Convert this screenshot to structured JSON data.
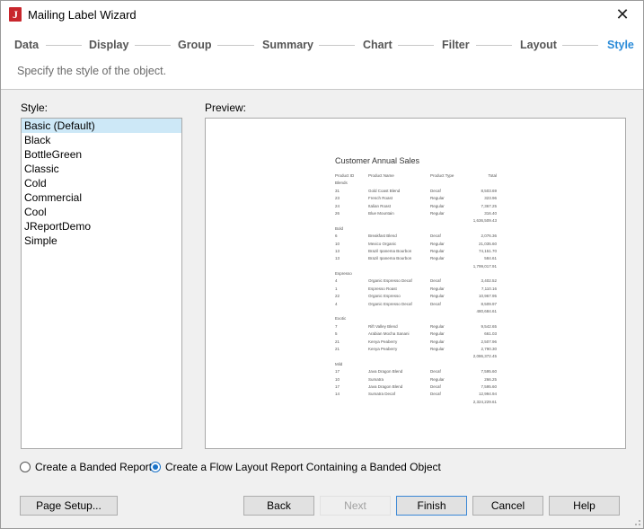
{
  "window": {
    "title": "Mailing Label Wizard",
    "app_icon_letter": "J",
    "close_glyph": "✕"
  },
  "steps": [
    "Data",
    "Display",
    "Group",
    "Summary",
    "Chart",
    "Filter",
    "Layout",
    "Style"
  ],
  "subtitle": "Specify the style of the object.",
  "style_label": "Style:",
  "preview_label": "Preview:",
  "styles": [
    "Basic (Default)",
    "Black",
    "BottleGreen",
    "Classic",
    "Cold",
    "Commercial",
    "Cool",
    "JReportDemo",
    "Simple"
  ],
  "selected_style": "Basic (Default)",
  "report": {
    "title": "Customer Annual Sales",
    "headers": [
      "Product ID",
      "Product Name",
      "Product Type",
      "Total"
    ],
    "rows": [
      [
        "Blends",
        "",
        "",
        ""
      ],
      [
        "31",
        "Gold Coast Blend",
        "Decaf",
        "8,503.69"
      ],
      [
        "23",
        "French Roast",
        "Regular",
        "323.96"
      ],
      [
        "24",
        "Italian Roast",
        "Regular",
        "7,367.25"
      ],
      [
        "26",
        "Blue Mountain",
        "Regular",
        "316.40"
      ],
      [
        "",
        "",
        "",
        "1,636,509.43"
      ],
      [
        "Bold",
        "",
        "",
        ""
      ],
      [
        "6",
        "Breakfast Blend",
        "Decaf",
        "2,076.36"
      ],
      [
        "10",
        "Mexico Organic",
        "Regular",
        "21,035.60"
      ],
      [
        "13",
        "Brazil Ipanema Bourbon",
        "Regular",
        "74,151.70"
      ],
      [
        "13",
        "Brazil Ipanema Bourbon",
        "Regular",
        "584.61"
      ],
      [
        "",
        "",
        "",
        "1,799,017.91"
      ],
      [
        "Espresso",
        "",
        "",
        ""
      ],
      [
        "4",
        "Organic Espresso Decaf",
        "Decaf",
        "3,402.52"
      ],
      [
        "1",
        "Espresso Roast",
        "Regular",
        "7,110.16"
      ],
      [
        "22",
        "Organic Espresso",
        "Regular",
        "10,967.95"
      ],
      [
        "4",
        "Organic Espresso Decaf",
        "Decaf",
        "8,509.97"
      ],
      [
        "",
        "",
        "",
        "480,684.61"
      ],
      [
        "Exotic",
        "",
        "",
        ""
      ],
      [
        "7",
        "Rift Valley Blend",
        "Regular",
        "9,542.65"
      ],
      [
        "5",
        "Arabian Mocha Sanani",
        "Regular",
        "661.03"
      ],
      [
        "21",
        "Kenya Peaberry",
        "Regular",
        "2,507.96"
      ],
      [
        "21",
        "Kenya Peaberry",
        "Regular",
        "2,790.30"
      ],
      [
        "",
        "",
        "",
        "2,086,372.45"
      ],
      [
        "Mild",
        "",
        "",
        ""
      ],
      [
        "17",
        "Java Dragon Blend",
        "Decaf",
        "7,595.60"
      ],
      [
        "10",
        "Sumatra",
        "Regular",
        "266.25"
      ],
      [
        "17",
        "Java Dragon Blend",
        "Decaf",
        "7,595.60"
      ],
      [
        "14",
        "Sumatra Decaf",
        "Decaf",
        "12,994.94"
      ],
      [
        "",
        "",
        "",
        "2,324,229.61"
      ]
    ]
  },
  "radio_options": {
    "banded": "Create a Banded Report",
    "flow": "Create a Flow Layout Report Containing a Banded Object",
    "selected": "flow"
  },
  "buttons": {
    "page_setup": "Page Setup...",
    "back": "Back",
    "next": "Next",
    "finish": "Finish",
    "cancel": "Cancel",
    "help": "Help"
  },
  "colors": {
    "accent": "#2a8bd8",
    "selection": "#cde8f7",
    "app_icon": "#c8262c"
  }
}
